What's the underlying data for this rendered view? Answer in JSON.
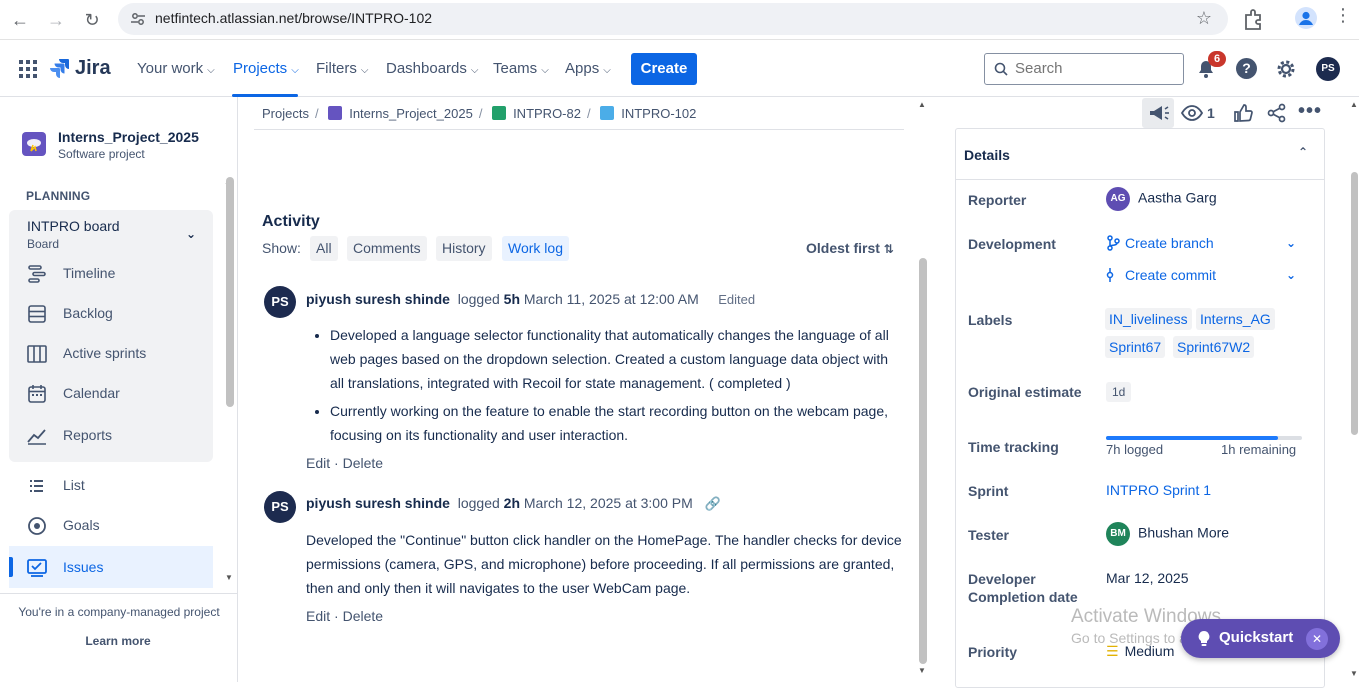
{
  "browser": {
    "url": "netfintech.atlassian.net/browse/INTPRO-102"
  },
  "topnav": {
    "product": "Jira",
    "items": [
      {
        "label": "Your work"
      },
      {
        "label": "Projects"
      },
      {
        "label": "Filters"
      },
      {
        "label": "Dashboards"
      },
      {
        "label": "Teams"
      },
      {
        "label": "Apps"
      }
    ],
    "create_label": "Create",
    "search_placeholder": "Search",
    "notification_count": "6",
    "user_initials": "PS"
  },
  "sidebar": {
    "project_name": "Interns_Project_2025",
    "project_type": "Software project",
    "planning_heading": "PLANNING",
    "board_name": "INTPRO board",
    "board_type": "Board",
    "planning_items": [
      {
        "label": "Timeline",
        "icon": "timeline-icon"
      },
      {
        "label": "Backlog",
        "icon": "backlog-icon"
      },
      {
        "label": "Active sprints",
        "icon": "active-sprints-icon"
      },
      {
        "label": "Calendar",
        "icon": "calendar-icon"
      },
      {
        "label": "Reports",
        "icon": "reports-icon"
      }
    ],
    "other_items": [
      {
        "label": "List",
        "icon": "list-icon"
      },
      {
        "label": "Goals",
        "icon": "goals-icon"
      },
      {
        "label": "Issues",
        "icon": "issues-icon"
      }
    ],
    "footer_text": "You're in a company-managed project",
    "learn_more": "Learn more"
  },
  "breadcrumb": [
    "Projects",
    "Interns_Project_2025",
    "INTPRO-82",
    "INTPRO-102"
  ],
  "activity": {
    "heading": "Activity",
    "show_label": "Show:",
    "tabs": [
      "All",
      "Comments",
      "History",
      "Work log"
    ],
    "selected_tab": "Work log",
    "sort_label": "Oldest first",
    "entries": [
      {
        "initials": "PS",
        "author": "piyush suresh shinde",
        "logged_word": "logged",
        "duration": "5h",
        "date": "March 11, 2025 at 12:00 AM",
        "edited": "Edited",
        "bullets": [
          "Developed a language selector functionality that automatically changes the language of all web pages based on the dropdown selection. Created a custom language data object with all translations, integrated with Recoil for state management. ( completed )",
          "Currently working on the feature to enable the start recording button on the webcam page, focusing on its functionality and user interaction."
        ],
        "edit": "Edit",
        "delete": "Delete"
      },
      {
        "initials": "PS",
        "author": "piyush suresh shinde",
        "logged_word": "logged",
        "duration": "2h",
        "date": "March 12, 2025 at 3:00 PM",
        "text": "Developed the \"Continue\" button click handler on the HomePage. The handler checks for device permissions (camera, GPS, and microphone) before proceeding. If all permissions are granted, then and only then it will navigates to the user  WebCam page.",
        "edit": "Edit",
        "delete": "Delete"
      }
    ]
  },
  "right_toolbar": {
    "watch_count": "1"
  },
  "details": {
    "heading": "Details",
    "reporter_label": "Reporter",
    "reporter_initials": "AG",
    "reporter_name": "Aastha Garg",
    "development_label": "Development",
    "create_branch": "Create branch",
    "create_commit": "Create commit",
    "labels_label": "Labels",
    "labels": [
      "IN_liveliness",
      "Interns_AG",
      "Sprint67",
      "Sprint67W2"
    ],
    "estimate_label": "Original estimate",
    "estimate_value": "1d",
    "time_tracking_label": "Time tracking",
    "time_logged": "7h logged",
    "time_remaining": "1h remaining",
    "time_progress": 0.875,
    "sprint_label": "Sprint",
    "sprint_value": "INTPRO Sprint 1",
    "tester_label": "Tester",
    "tester_initials": "BM",
    "tester_name": "Bhushan More",
    "dev_completion_label_1": "Developer",
    "dev_completion_label_2": "Completion date",
    "dev_completion_value": "Mar 12, 2025",
    "priority_label": "Priority",
    "priority_value": "Medium"
  },
  "overlay": {
    "watermark_title": "Activate Windows",
    "watermark_sub": "Go to Settings to activate Windows.",
    "quickstart": "Quickstart"
  },
  "colors": {
    "brand_blue": "#0c66e4",
    "quickstart_purple": "#5e4db2"
  }
}
